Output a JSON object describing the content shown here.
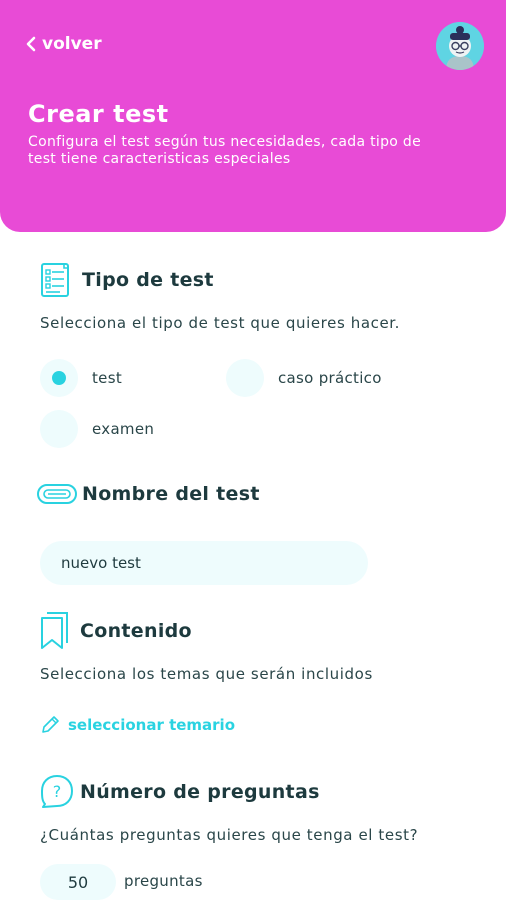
{
  "header": {
    "back_label": "volver",
    "title": "Crear test",
    "subtitle": "Configura el test según tus necesidades, cada tipo de test tiene caracteristicas especiales",
    "color": "#e84bd6"
  },
  "tipo": {
    "heading": "Tipo de test",
    "description": "Selecciona el tipo de test que quieres hacer.",
    "options": [
      {
        "label": "test",
        "selected": true
      },
      {
        "label": "caso práctico",
        "selected": false
      },
      {
        "label": "examen",
        "selected": false
      }
    ]
  },
  "nombre": {
    "heading": "Nombre del test",
    "value": "nuevo test"
  },
  "contenido": {
    "heading": "Contenido",
    "description": "Selecciona los temas que serán incluidos",
    "link_label": "seleccionar temario"
  },
  "preguntas": {
    "heading": "Número de preguntas",
    "description": "¿Cuántas preguntas quieres que tenga el test?",
    "value": "50",
    "unit": "preguntas"
  },
  "accent_color": "#29d2e0",
  "icons": [
    "chevron-left-icon",
    "avatar",
    "checklist-icon",
    "name-tag-icon",
    "bookmark-icon",
    "question-bubble-icon",
    "pencil-icon"
  ]
}
